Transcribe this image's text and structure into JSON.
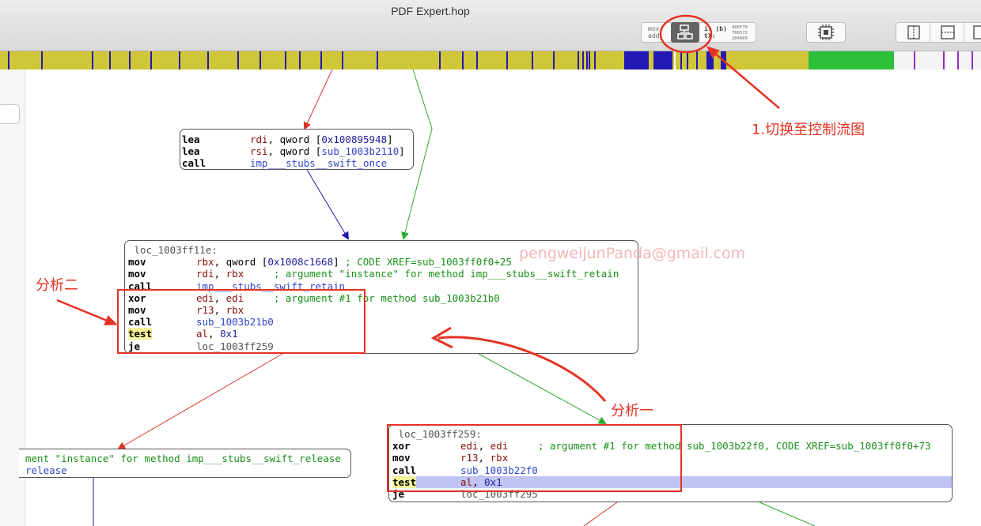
{
  "window": {
    "title": "PDF Expert.hop"
  },
  "toolbar": {
    "mode_asm_line1": "mov",
    "mode_asm_line2": "add",
    "mode_hex_line1": "i: (b)",
    "mode_hex_line2": "tX:",
    "mode_hex_values": [
      "486F70",
      "706572",
      "204469"
    ]
  },
  "watermark": "pengweijunPanda@gmail.com",
  "annotations": {
    "switch_label": "1.切换至控制流图",
    "analysis_two": "分析二",
    "analysis_one": "分析一"
  },
  "blocks": {
    "top": {
      "rows": [
        {
          "mn": "lea",
          "ops": [
            {
              "t": "rdi",
              "c": "reg"
            },
            {
              "t": ", qword ["
            },
            {
              "t": "0x100895948",
              "c": "num"
            },
            {
              "t": "]"
            }
          ]
        },
        {
          "mn": "lea",
          "ops": [
            {
              "t": "rsi",
              "c": "reg"
            },
            {
              "t": ", qword ["
            },
            {
              "t": "sub_1003b2110",
              "c": "sym"
            },
            {
              "t": "]"
            }
          ]
        },
        {
          "mn": "call",
          "ops": [
            {
              "t": "imp___stubs__swift_once",
              "c": "sym"
            }
          ]
        }
      ]
    },
    "middle": {
      "label": "loc_1003ff11e:",
      "rows": [
        {
          "mn": "mov",
          "ops": [
            {
              "t": "rbx",
              "c": "reg"
            },
            {
              "t": ", qword ["
            },
            {
              "t": "0x1008c1668",
              "c": "num"
            },
            {
              "t": "] "
            },
            {
              "t": "; CODE XREF=sub_1003ff0f0+25",
              "c": "cmt"
            }
          ]
        },
        {
          "mn": "mov",
          "ops": [
            {
              "t": "rdi",
              "c": "reg"
            },
            {
              "t": ", "
            },
            {
              "t": "rbx",
              "c": "reg"
            },
            {
              "t": "     "
            },
            {
              "t": "; argument \"instance\" for method imp___stubs__swift_retain",
              "c": "cmt"
            }
          ]
        },
        {
          "mn": "call",
          "ops": [
            {
              "t": "imp___stubs__swift_retain",
              "c": "sym"
            }
          ]
        },
        {
          "mn": "xor",
          "ops": [
            {
              "t": "edi",
              "c": "reg"
            },
            {
              "t": ", "
            },
            {
              "t": "edi",
              "c": "reg"
            },
            {
              "t": "     "
            },
            {
              "t": "; argument #1 for method sub_1003b21b0",
              "c": "cmt"
            }
          ]
        },
        {
          "mn": "mov",
          "ops": [
            {
              "t": "r13",
              "c": "reg"
            },
            {
              "t": ", "
            },
            {
              "t": "rbx",
              "c": "reg"
            }
          ]
        },
        {
          "mn": "call",
          "ops": [
            {
              "t": "sub_1003b21b0",
              "c": "sym"
            }
          ]
        },
        {
          "mn": "test",
          "hl": true,
          "ops": [
            {
              "t": "al",
              "c": "reg"
            },
            {
              "t": ", "
            },
            {
              "t": "0x1",
              "c": "num"
            }
          ]
        },
        {
          "mn": "je",
          "ops": [
            {
              "t": "loc_1003ff259",
              "c": "lbl"
            }
          ]
        }
      ]
    },
    "left": {
      "rows": [
        {
          "mn": "",
          "ops": [
            {
              "t": "ment \"instance\" for method imp___stubs__swift_release",
              "c": "cmt"
            }
          ]
        },
        {
          "mn": "",
          "ops": [
            {
              "t": "release",
              "c": "sym"
            }
          ]
        }
      ]
    },
    "right": {
      "label": "loc_1003ff259:",
      "rows": [
        {
          "mn": "xor",
          "ops": [
            {
              "t": "edi",
              "c": "reg"
            },
            {
              "t": ", "
            },
            {
              "t": "edi",
              "c": "reg"
            },
            {
              "t": "     "
            },
            {
              "t": "; argument #1 for method sub_1003b22f0, CODE XREF=sub_1003ff0f0+73",
              "c": "cmt"
            }
          ]
        },
        {
          "mn": "mov",
          "ops": [
            {
              "t": "r13",
              "c": "reg"
            },
            {
              "t": ", "
            },
            {
              "t": "rbx",
              "c": "reg"
            }
          ]
        },
        {
          "mn": "call",
          "ops": [
            {
              "t": "sub_1003b22f0",
              "c": "sym"
            }
          ]
        },
        {
          "mn": "test",
          "hl": true,
          "selected": true,
          "ops": [
            {
              "t": "al",
              "c": "reg"
            },
            {
              "t": ", "
            },
            {
              "t": "0x1",
              "c": "num"
            }
          ]
        },
        {
          "mn": "je",
          "ops": [
            {
              "t": "loc_1003ff295",
              "c": "lbl"
            }
          ]
        }
      ]
    }
  },
  "colors": {
    "nav_base": "#cfc737",
    "nav_mark": "#2418b4",
    "nav_green": "#2ebf3a",
    "nav_purple": "#9b2cc0",
    "edge_true": "#2eaa2e",
    "edge_false": "#d8342a",
    "edge_plain": "#1b1bb0",
    "annotation": "#e53222"
  }
}
